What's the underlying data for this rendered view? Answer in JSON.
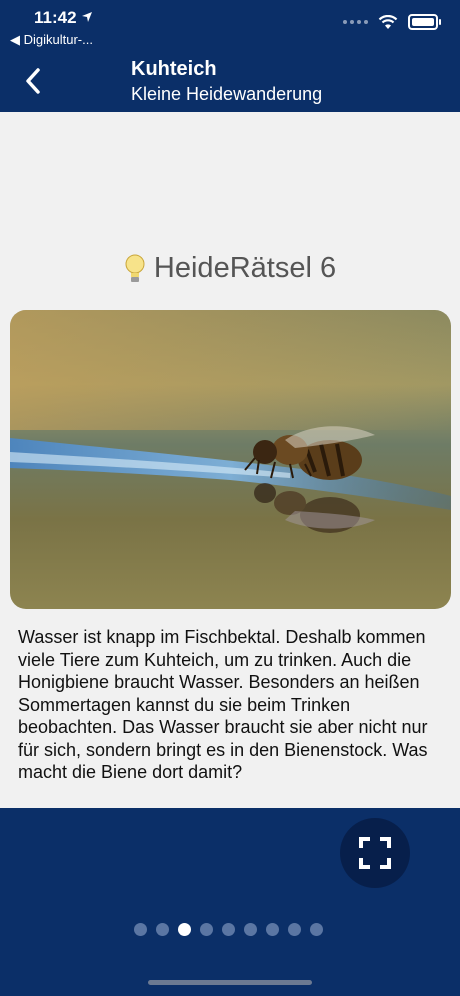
{
  "status": {
    "time": "11:42",
    "back_app": "Digikultur-..."
  },
  "header": {
    "title": "Kuhteich",
    "subtitle": "Kleine Heidewanderung"
  },
  "card": {
    "heading": "HeideRätsel 6",
    "description": "Wasser ist knapp im Fischbektal. Deshalb kommen viele Tiere zum Kuhteich, um zu trinken. Auch die Honigbiene braucht Wasser. Besonders an heißen Sommertagen kannst du sie beim Trinken beobachten. Das Wasser braucht sie aber nicht nur für sich, sondern bringt es in den Bienenstock. Was macht die Biene dort damit?"
  },
  "icons": {
    "back": "chevron-left-icon",
    "hint": "lightbulb-icon",
    "expand": "fullscreen-icon",
    "location": "location-arrow-icon",
    "wifi": "wifi-icon",
    "battery": "battery-icon"
  },
  "pager": {
    "count": 9,
    "active_index": 2
  },
  "colors": {
    "header_bg": "#0b2f68",
    "background": "#f1f1f1",
    "button_bg": "#071f4b"
  }
}
